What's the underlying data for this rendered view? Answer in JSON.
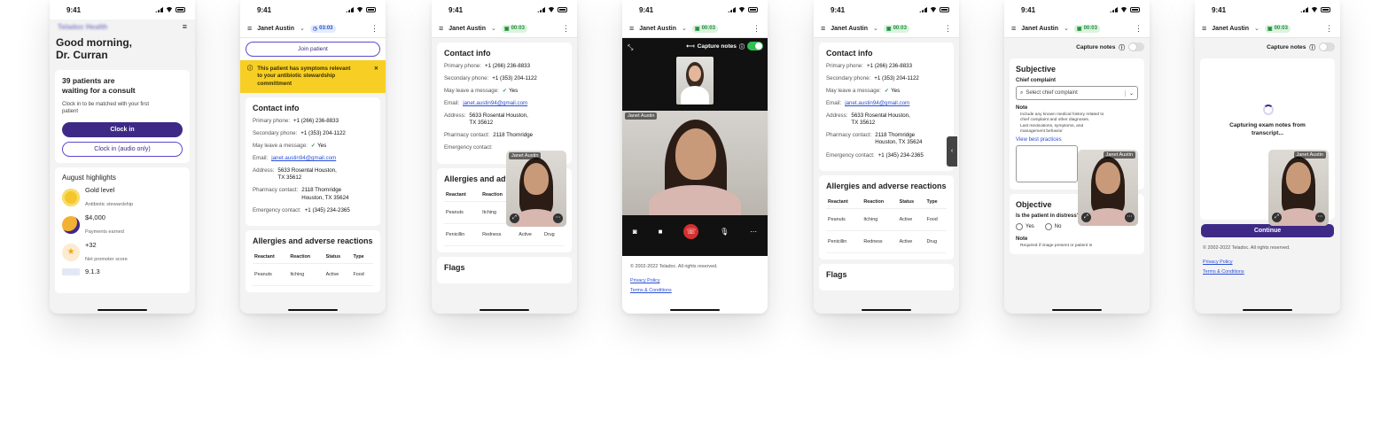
{
  "status_time": "9:41",
  "patient_name": "Janet Austin",
  "timers": {
    "blue": "03:03",
    "green": "00:03"
  },
  "s1": {
    "logo": "Teladoc Health",
    "greeting": "Good morning, Dr. Curran",
    "waiting_title": "39 patients are waiting for a consult",
    "clock_desc": "Clock in to be matched with your first patient",
    "clock_in": "Clock in",
    "clock_in_audio": "Clock in (audio only)",
    "highlights_title": "August highlights",
    "highlights": [
      {
        "title": "Gold level",
        "sub": "Antibiotic stewardship"
      },
      {
        "title": "$4,000",
        "sub": "Payments earned"
      },
      {
        "title": "+32",
        "sub": "Net promoter score"
      },
      {
        "title": "9.1.3",
        "sub": ""
      }
    ]
  },
  "s2": {
    "join": "Join patient",
    "banner": "This patient has symptoms relevant to your antibiotic stewardship committment"
  },
  "contact": {
    "title": "Contact info",
    "primary_label": "Primary phone:",
    "primary": "+1 (266) 236-8833",
    "secondary_label": "Secondary phone:",
    "secondary": "+1 (353) 204-1122",
    "msg_label": "May leave a message:",
    "msg": "Yes",
    "email_label": "Email:",
    "email": "janet.austin94@gmail.com",
    "address_label": "Address:",
    "address": "5633 Rosental Houston, TX 35612",
    "pharmacy_label": "Pharmacy contact:",
    "pharmacy": "2118 Thornridge Houston, TX 35624",
    "emergency_label": "Emergency contact:",
    "emergency": "+1 (345) 234-2365"
  },
  "allergies": {
    "title": "Allergies and adverse reactions",
    "title_short": "Allergies and adverse",
    "headers": [
      "Reactant",
      "Reaction",
      "Status",
      "Type"
    ],
    "rows": [
      [
        "Peanuts",
        "Itching",
        "Active",
        "Food"
      ],
      [
        "Penicillin",
        "Redness",
        "Active",
        "Drug"
      ]
    ]
  },
  "flags": "Flags",
  "capture_notes": "Capture notes",
  "footer": {
    "copyright": "© 2002-2022 Teladoc. All rights reserved.",
    "privacy": "Privacy Policy",
    "terms": "Terms & Conditions"
  },
  "s6": {
    "subjective": "Subjective",
    "chief": "Chief complaint",
    "select": "Select chief complaint",
    "note": "Note",
    "bullets": [
      "Include any known medical history related to chief complaint and other diagnoses.",
      "Last medications, symptoms, and management behavior"
    ],
    "best": "View best practices",
    "objective": "Objective",
    "distress": "Is the patient in distress?",
    "yes": "Yes",
    "no": "No",
    "note2": "Note",
    "bullet2": "Required if image present or patient in"
  },
  "s7": {
    "capturing": "Capturing exam notes from transcript...",
    "continue": "Continue"
  },
  "colors": {
    "brand": "#3e2a86",
    "banner": "#f7cf24",
    "live": "#2fc153",
    "end_call": "#d32f2f"
  }
}
